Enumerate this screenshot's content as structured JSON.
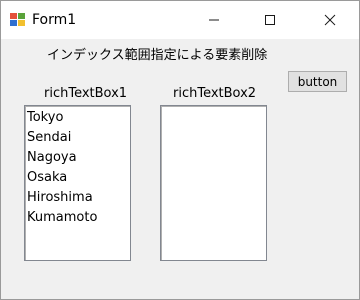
{
  "window": {
    "title": "Form1",
    "controls": {
      "minimize": "—",
      "maximize": "☐",
      "close": "✕"
    }
  },
  "form": {
    "heading": "インデックス範囲指定による要素削除",
    "button_label": "button",
    "rich_text_box_1": {
      "label": "richTextBox1",
      "lines": [
        "Tokyo",
        "Sendai",
        "Nagoya",
        "Osaka",
        "Hiroshima",
        "Kumamoto"
      ]
    },
    "rich_text_box_2": {
      "label": "richTextBox2",
      "lines": []
    }
  },
  "colors": {
    "form_background": "#f0f0f0",
    "titlebar_background": "#ffffff",
    "button_background": "#e1e1e1",
    "textbox_background": "#ffffff"
  },
  "icons": {
    "app": "windows-form-icon"
  }
}
